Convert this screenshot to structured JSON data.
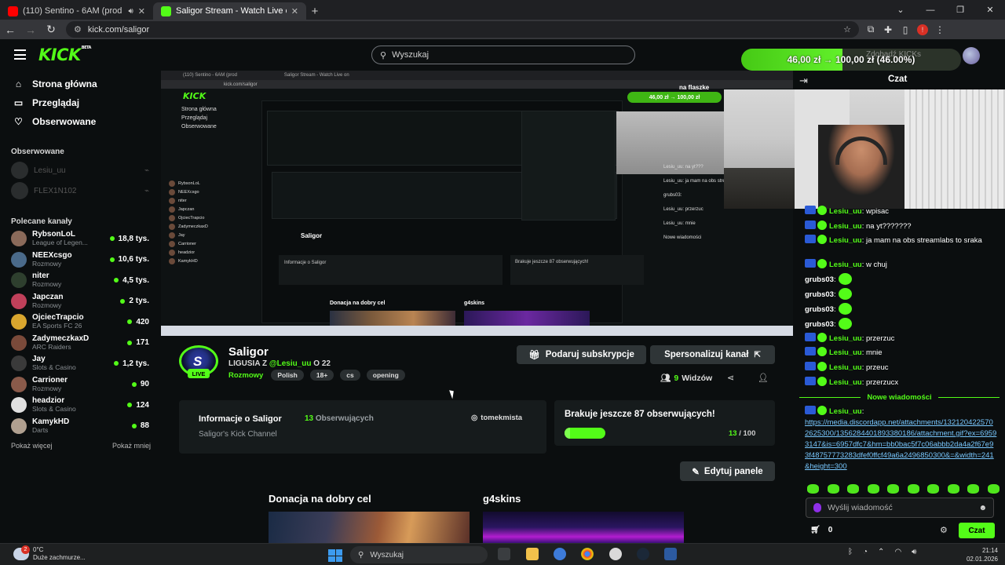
{
  "browser": {
    "tabs": [
      {
        "title": "(110) Sentino - 6AM (prod",
        "active": false,
        "favicon_color": "#ff0000"
      },
      {
        "title": "Saligor Stream - Watch Live on",
        "active": true,
        "favicon_color": "#53fc18"
      }
    ],
    "url": "kick.com/saligor",
    "profile_badge": "!"
  },
  "header": {
    "logo": "KICK",
    "logo_beta": "BETA",
    "search_placeholder": "Wyszukaj",
    "overlay_title": "na flaszke",
    "goal_text": "46,00 zł → 100,00 zł (46.00%)",
    "goal_fraction": 0.46,
    "kicks_label": "Zdobądź KICKs"
  },
  "sidebar": {
    "nav": [
      {
        "label": "Strona główna",
        "icon": "home-icon",
        "glyph": "⌂"
      },
      {
        "label": "Przeglądaj",
        "icon": "browse-icon",
        "glyph": "▭"
      },
      {
        "label": "Obserwowane",
        "icon": "heart-icon",
        "glyph": "♡"
      }
    ],
    "followed_title": "Obserwowane",
    "followed": [
      {
        "name": "Lesiu_uu"
      },
      {
        "name": "FLEX1N102"
      }
    ],
    "recommended_title": "Polecane kanały",
    "recommended": [
      {
        "name": "RybsonLoL",
        "category": "League of Legen...",
        "viewers": "18,8 tys.",
        "color": "#8a6a5a"
      },
      {
        "name": "NEEXcsgo",
        "category": "Rozmowy",
        "viewers": "10,6 tys.",
        "color": "#4a6a8a"
      },
      {
        "name": "niter",
        "category": "Rozmowy",
        "viewers": "4,5 tys.",
        "color": "#2e3f2e"
      },
      {
        "name": "Japczan",
        "category": "Rozmowy",
        "viewers": "2 tys.",
        "color": "#c0405a"
      },
      {
        "name": "OjciecTrapcio",
        "category": "EA Sports FC 26",
        "viewers": "420",
        "color": "#d9a62e"
      },
      {
        "name": "ZadymeczkaxD",
        "category": "ARC Raiders",
        "viewers": "171",
        "color": "#7a4a3a"
      },
      {
        "name": "Jay",
        "category": "Slots & Casino",
        "viewers": "1,2 tys.",
        "color": "#3a3a3a"
      },
      {
        "name": "Carrioner",
        "category": "Rozmowy",
        "viewers": "90",
        "color": "#8a5a4a"
      },
      {
        "name": "headzior",
        "category": "Slots & Casino",
        "viewers": "124",
        "color": "#e0e0e0"
      },
      {
        "name": "KamykHD",
        "category": "Darts",
        "viewers": "88",
        "color": "#b0a090"
      }
    ],
    "show_more": "Pokaż więcej",
    "show_less": "Pokaż mniej"
  },
  "channel": {
    "avatar_letter": "S",
    "live_label": "LIVE",
    "name": "Saligor",
    "subtitle_prefix": "LIGUSIA Z ",
    "subtitle_mention": "@Lesiu_uu",
    "subtitle_suffix": " O 22",
    "category": "Rozmowy",
    "tags": [
      "Polish",
      "18+",
      "cs",
      "opening"
    ],
    "gift_button": "Podaruj subskrypcje",
    "personalize_button": "Spersonalizuj kanał",
    "viewers_count": "9",
    "viewers_label": "Widzów"
  },
  "about": {
    "title": "Informacje o Saligor",
    "followers_count": "13",
    "followers_label": "Obserwujących",
    "description": "Saligor's Kick Channel",
    "instagram": "tomekmista"
  },
  "follower_goal": {
    "title": "Brakuje jeszcze 87 obserwujących!",
    "current": "13",
    "target": "/ 100",
    "fraction": 0.13
  },
  "panels": {
    "edit_button": "Edytuj panele",
    "donation_title": "Donacja na dobry cel",
    "g4skins_title": "g4skins"
  },
  "stream_overlay": {
    "inner_tab1": "(110) Sentino - 6AM (prod",
    "inner_tab2": "Saligor Stream - Watch Live on",
    "inner_url": "kick.com/saligor",
    "inner_logo": "KICK",
    "inner_nav": [
      "Strona główna",
      "Przeglądaj",
      "Obserwowane"
    ],
    "inner_flaszke": "na flaszke",
    "inner_goal": "46,00 zł → 100,00 zł",
    "inner_name": "Saligor",
    "inner_about": "Informacje o Saligor",
    "inner_missing": "Brakuje jeszcze 87 obserwujących!",
    "inner_don": "Donacja na dobry cel",
    "inner_g4": "g4skins",
    "inner_chat": [
      "Lesiu_uu: na yt???",
      "Lesiu_uu: ja mam na obs streamlabs to sraka",
      "grubs03:",
      "Lesiu_uu: przerzuc",
      "Lesiu_uu: mnie",
      "Nowe wiadomości"
    ]
  },
  "chat": {
    "title": "Czat",
    "messages": [
      {
        "user": "Lesiu_uu",
        "text": ": wpisac",
        "type": "user"
      },
      {
        "user": "Lesiu_uu",
        "text": ": na yt???????",
        "type": "user"
      },
      {
        "user": "Lesiu_uu",
        "text": ": ja mam na obs streamlabs to sraka",
        "type": "user"
      },
      {
        "user": "Lesiu_uu",
        "text": ": w chuj",
        "type": "user"
      },
      {
        "user": "grubs03",
        "text": ":",
        "type": "emote"
      },
      {
        "user": "grubs03",
        "text": ":",
        "type": "emote"
      },
      {
        "user": "grubs03",
        "text": ":",
        "type": "emote"
      },
      {
        "user": "grubs03",
        "text": ":",
        "type": "emote"
      },
      {
        "user": "Lesiu_uu",
        "text": ": przerzuc",
        "type": "user"
      },
      {
        "user": "Lesiu_uu",
        "text": ": mnie",
        "type": "user"
      },
      {
        "user": "Lesiu_uu",
        "text": ": przeuc",
        "type": "user"
      },
      {
        "user": "Lesiu_uu",
        "text": ": przerzucx",
        "type": "user"
      }
    ],
    "new_messages_label": "Nowe wiadomości",
    "link_message_user": "Lesiu_uu",
    "link_message_url": "https://media.discordapp.net/attachments/1321204225702625300/1356284401893380186/attachment.gif?ex=69593147&is=6957dfc7&hm=bb0bac5f7c06abbb2da4a2f67e93f48757773283dfef0ffcf49a6a2496850300&=&width=241&height=300",
    "input_placeholder": "Wyślij wiadomość",
    "points": "0",
    "send_button": "Czat"
  },
  "taskbar": {
    "temperature": "0°C",
    "weather": "Duże zachmurze...",
    "notif_count": "2",
    "search": "Wyszukaj",
    "time": "21:14",
    "date": "02.01.2026"
  }
}
